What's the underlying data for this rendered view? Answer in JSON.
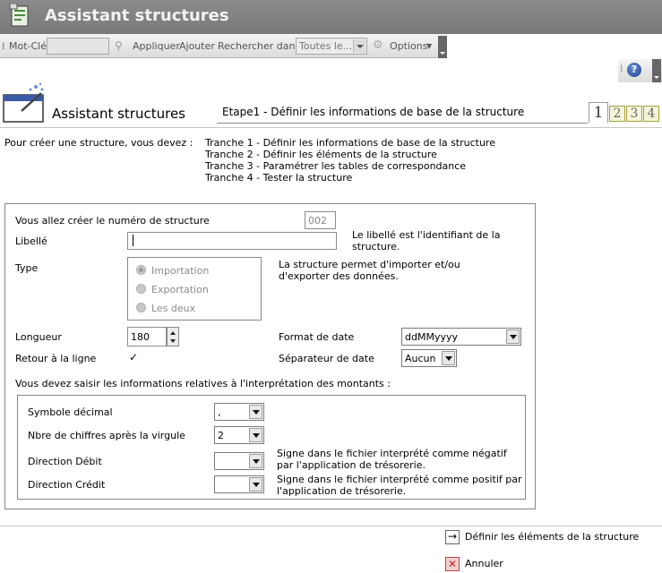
{
  "app": {
    "title": "Assistant structures"
  },
  "toolbar": {
    "keyword_label": "Mot-Clé",
    "apply_label": "Appliquer",
    "add_label": "Ajouter",
    "search_in_label": "Rechercher dans",
    "search_in_value": "Toutes le...",
    "options_label": "Options"
  },
  "header": {
    "title": "Assistant structures",
    "step_title": "Etape1 - Définir les informations de base de la structure",
    "steps": [
      "1",
      "2",
      "3",
      "4"
    ],
    "active_step": 1
  },
  "intro": {
    "prefix": "Pour créer une structure, vous devez :",
    "lines": [
      "Tranche 1 - Définir les informations de base de la structure",
      "Tranche 2 - Définir les éléments de la structure",
      "Tranche 3 - Paramétrer les tables de correspondance",
      "Tranche 4 - Tester la structure"
    ]
  },
  "form": {
    "structure_number_label": "Vous allez créer le numéro de structure",
    "structure_number_value": "002",
    "libelle_label": "Libellé",
    "libelle_value": "",
    "libelle_hint": "Le libellé est l'identifiant de la structure.",
    "type_label": "Type",
    "type_options": [
      "Importation",
      "Exportation",
      "Les deux"
    ],
    "type_selected": "Importation",
    "type_hint": "La structure permet d'importer et/ou d'exporter des données.",
    "longueur_label": "Longueur",
    "longueur_value": "180",
    "retour_label": "Retour à la ligne",
    "retour_checked": true,
    "format_date_label": "Format de date",
    "format_date_value": "ddMMyyyy",
    "separateur_label": "Séparateur de date",
    "separateur_value": "Aucun",
    "amounts_intro": "Vous devez saisir les informations relatives à l'interprétation des montants :",
    "symbole_label": "Symbole décimal",
    "symbole_value": ",",
    "nbre_label": "Nbre de chiffres après la virgule",
    "nbre_value": "2",
    "debit_label": "Direction Débit",
    "debit_value": "",
    "debit_hint": "Signe dans le fichier interprété comme négatif par l'application de trésorerie.",
    "credit_label": "Direction Crédit",
    "credit_value": "",
    "credit_hint": "Signe dans le fichier interprété comme positif par l'application de trésorerie."
  },
  "actions": {
    "next_label": "Définir les éléments de la structure",
    "cancel_label": "Annuler"
  },
  "colors": {
    "titlebar": "#7f7f7f",
    "step_box": "#f6f4d8"
  }
}
